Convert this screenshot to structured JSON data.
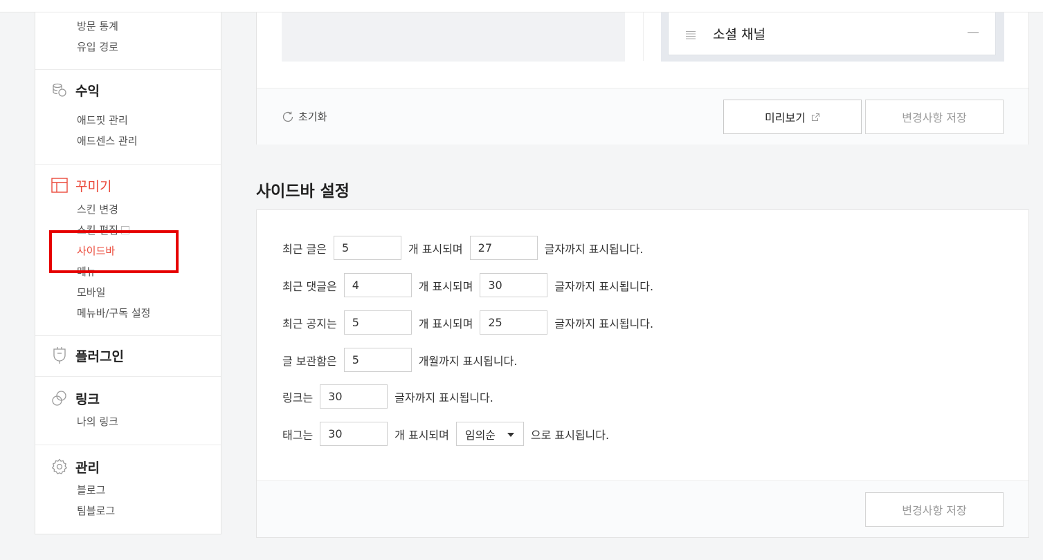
{
  "sidebar": {
    "stats": {
      "items": [
        {
          "label": "방문 통계"
        },
        {
          "label": "유입 경로"
        }
      ]
    },
    "revenue": {
      "title": "수익",
      "icon": "coins-icon",
      "items": [
        {
          "label": "애드핏 관리"
        },
        {
          "label": "애드센스 관리"
        }
      ]
    },
    "decorate": {
      "title": "꾸미기",
      "icon": "layout-icon",
      "items": [
        {
          "label": "스킨 변경"
        },
        {
          "label": "스킨 편집"
        },
        {
          "label": "사이드바"
        },
        {
          "label": "메뉴"
        },
        {
          "label": "모바일"
        },
        {
          "label": "메뉴바/구독 설정"
        }
      ],
      "active_item": "사이드바"
    },
    "plugin": {
      "title": "플러그인",
      "icon": "plug-icon"
    },
    "link": {
      "title": "링크",
      "icon": "link-icon",
      "items": [
        {
          "label": "나의 링크"
        }
      ]
    },
    "manage": {
      "title": "관리",
      "icon": "gear-icon",
      "items": [
        {
          "label": "블로그"
        },
        {
          "label": "팀블로그"
        }
      ]
    }
  },
  "preview": {
    "social_channel_label": "소셜 채널"
  },
  "top_actions": {
    "reset_label": "초기화",
    "preview_label": "미리보기",
    "save_label": "변경사항 저장"
  },
  "sidebar_settings": {
    "title": "사이드바 설정",
    "recent_posts": {
      "label": "최근 글은",
      "count": "5",
      "mid": "개 표시되며",
      "chars": "27",
      "end": "글자까지 표시됩니다."
    },
    "recent_comments": {
      "label": "최근 댓글은",
      "count": "4",
      "mid": "개 표시되며",
      "chars": "30",
      "end": "글자까지 표시됩니다."
    },
    "recent_notices": {
      "label": "최근 공지는",
      "count": "5",
      "mid": "개 표시되며",
      "chars": "25",
      "end": "글자까지 표시됩니다."
    },
    "archive": {
      "label": "글 보관함은",
      "months": "5",
      "end": "개월까지 표시됩니다."
    },
    "links": {
      "label": "링크는",
      "chars": "30",
      "end": "글자까지 표시됩니다."
    },
    "tags": {
      "label": "태그는",
      "count": "30",
      "mid": "개 표시되며",
      "order": "임의순",
      "end": "으로 표시됩니다."
    },
    "save_label": "변경사항 저장"
  },
  "colors": {
    "accent": "#eb4a3b",
    "highlight": "#e60000"
  }
}
